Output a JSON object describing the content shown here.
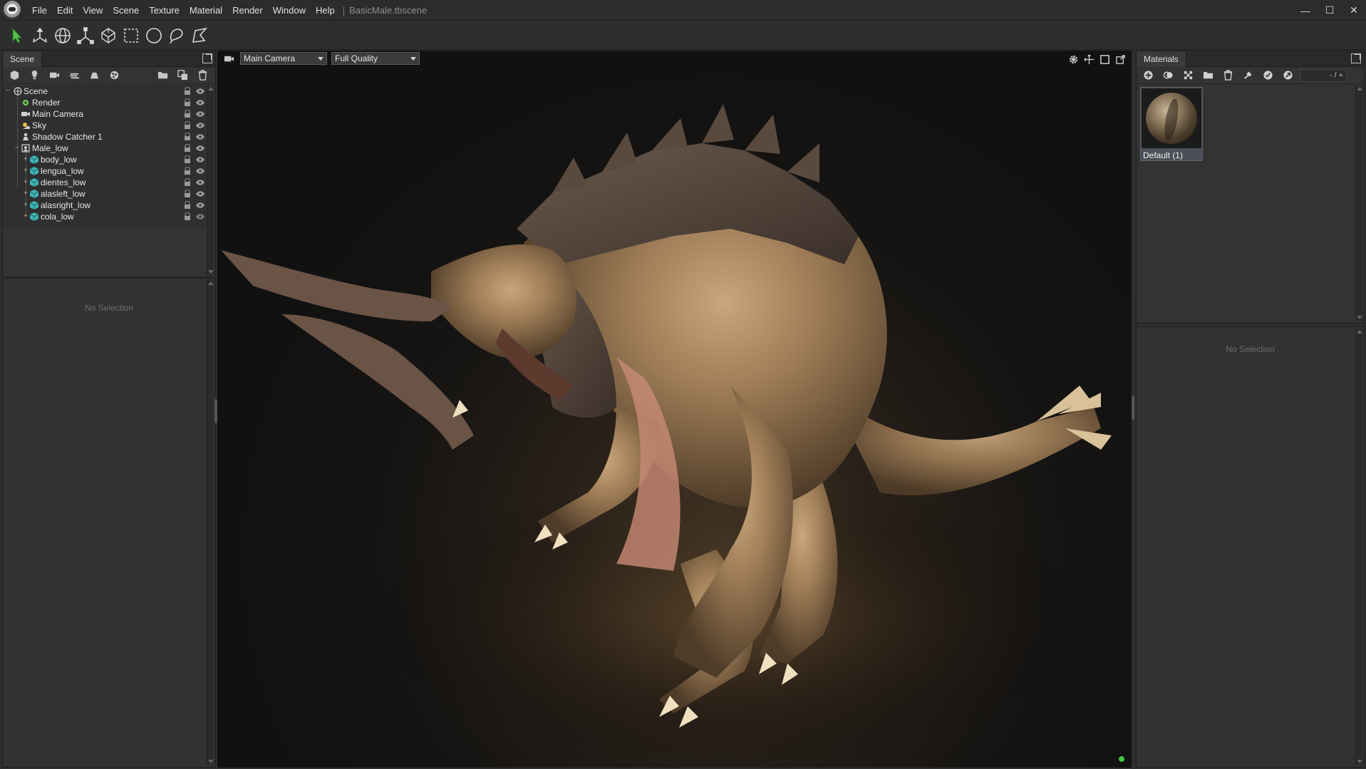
{
  "window": {
    "file_name": "BasicMale.tbscene",
    "menu": [
      "File",
      "Edit",
      "View",
      "Scene",
      "Texture",
      "Material",
      "Render",
      "Window",
      "Help"
    ],
    "separator": "|",
    "controls": {
      "minimize": "—",
      "maximize": "☐",
      "close": "✕"
    }
  },
  "toolbar": {
    "tools": [
      "select-arrow-icon",
      "transform-icon",
      "rotate-icon",
      "scale-icon",
      "cage-icon",
      "rect-select-icon",
      "circle-select-icon",
      "lasso-select-icon",
      "poly-select-icon"
    ]
  },
  "scene_panel": {
    "tab_label": "Scene",
    "tree": [
      {
        "label": "Scene",
        "depth": 0,
        "icon": "scene-icon"
      },
      {
        "label": "Render",
        "depth": 1,
        "icon": "render-icon"
      },
      {
        "label": "Main Camera",
        "depth": 1,
        "icon": "camera-icon"
      },
      {
        "label": "Sky",
        "depth": 1,
        "icon": "sky-icon"
      },
      {
        "label": "Shadow Catcher 1",
        "depth": 1,
        "icon": "shadow-catcher-icon"
      },
      {
        "label": "Male_low",
        "depth": 1,
        "icon": "model-icon"
      },
      {
        "label": "body_low",
        "depth": 2,
        "icon": "mesh-icon"
      },
      {
        "label": "lengua_low",
        "depth": 2,
        "icon": "mesh-icon"
      },
      {
        "label": "dientes_low",
        "depth": 2,
        "icon": "mesh-icon"
      },
      {
        "label": "alasleft_low",
        "depth": 2,
        "icon": "mesh-icon"
      },
      {
        "label": "alasright_low",
        "depth": 2,
        "icon": "mesh-icon"
      },
      {
        "label": "cola_low",
        "depth": 2,
        "icon": "mesh-icon"
      }
    ],
    "properties_empty": "No Selection"
  },
  "viewport": {
    "camera": "Main Camera",
    "quality": "Full Quality",
    "status_color": "#3ecb3e"
  },
  "materials_panel": {
    "tab_label": "Materials",
    "pager": "- / +",
    "materials": [
      {
        "label": "Default (1)"
      }
    ],
    "properties_empty": "No Selection"
  },
  "colors": {
    "accent_green": "#54c24a",
    "mesh_teal": "#3fb4b4"
  }
}
